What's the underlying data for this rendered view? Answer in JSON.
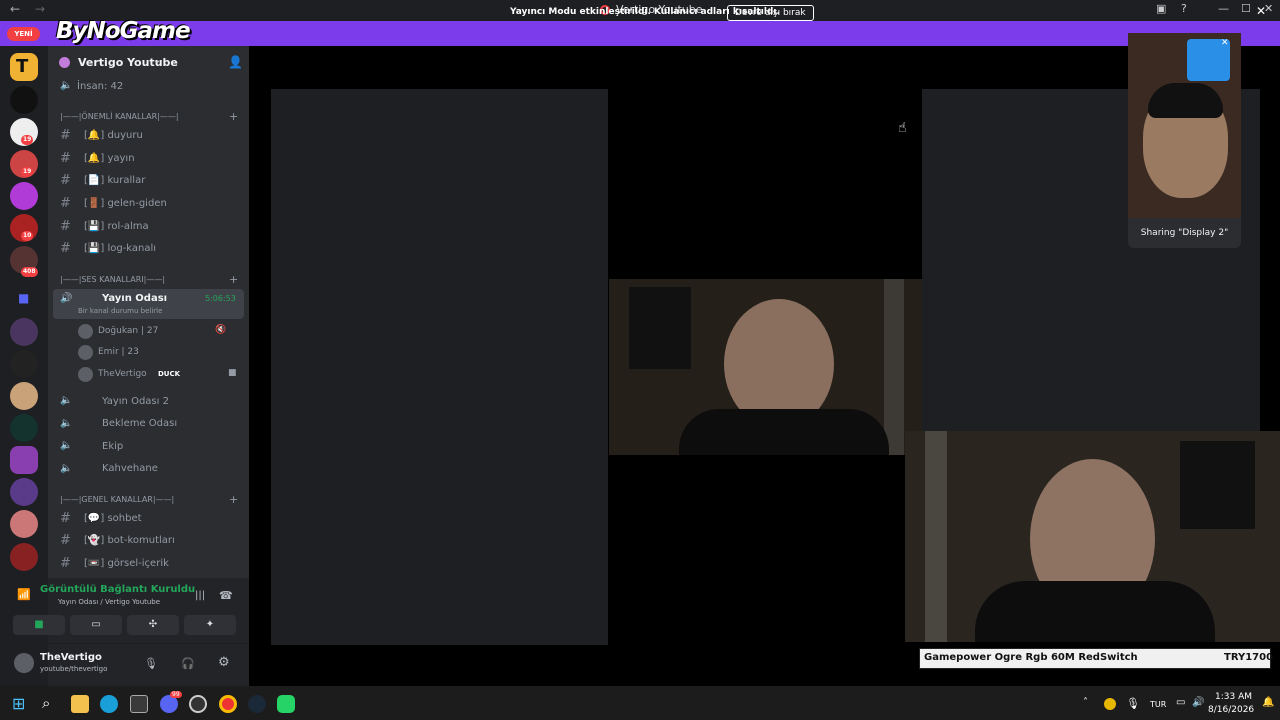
{
  "window": {
    "title": "Vertigo Youtube",
    "back": "←",
    "forward": "→"
  },
  "banner": {
    "text": "Yayıncı Modu etkinleştirildi. Kullanıcı adları kısaltıldı.",
    "button": "Devre dışı bırak"
  },
  "overlay": {
    "watermark": "ByNoGame",
    "new_badge": "YENİ"
  },
  "guilds": {
    "badges": [
      "19",
      "19",
      "10",
      "408"
    ]
  },
  "server": {
    "name": "Vertigo Youtube",
    "member_count": "İnsan: 42"
  },
  "categories": {
    "important": "|——|ÖNEMLİ KANALLAR|——|",
    "voice": "|——|SES KANALLARI|——|",
    "general": "|——|GENEL KANALLAR|——|"
  },
  "text_channels_top": [
    {
      "name": "duyuru",
      "emoji": "🔔"
    },
    {
      "name": "yayın",
      "emoji": "🔔"
    },
    {
      "name": "kurallar",
      "emoji": "📄"
    },
    {
      "name": "gelen-giden",
      "emoji": "🚪"
    },
    {
      "name": "rol-alma",
      "emoji": "💾"
    },
    {
      "name": "log-kanalı",
      "emoji": "💾"
    }
  ],
  "voice_channels": {
    "active": {
      "name": "Yayın Odası",
      "timer": "5:06:53",
      "status": "Bir kanal durumu belirle"
    },
    "users": [
      {
        "name": "Doğukan | 27"
      },
      {
        "name": "Emir | 23"
      },
      {
        "name": "TheVertigo",
        "badge": "DUCK"
      }
    ],
    "others": [
      "Yayın Odası 2",
      "Bekleme Odası",
      "Ekip",
      "Kahvehane"
    ]
  },
  "text_channels_general": [
    {
      "name": "sohbet",
      "emoji": "💬"
    },
    {
      "name": "bot-komutları",
      "emoji": "👻"
    },
    {
      "name": "görsel-içerik",
      "emoji": "📼"
    }
  ],
  "voice_panel": {
    "title": "Görüntülü Bağlantı Kuruldu",
    "subtitle": "Yayın Odası / Vertigo Youtube"
  },
  "user": {
    "name": "TheVertigo",
    "status": "youtube/thevertigo"
  },
  "share": {
    "label": "Sharing \"Display 2\""
  },
  "ticker": {
    "text": "Gamepower Ogre Rgb 60M RedSwitch",
    "price": "TRY1700"
  },
  "taskbar": {
    "lang": "TUR",
    "time": "1:33 AM",
    "date": "8/16/2026",
    "badge": "99"
  }
}
